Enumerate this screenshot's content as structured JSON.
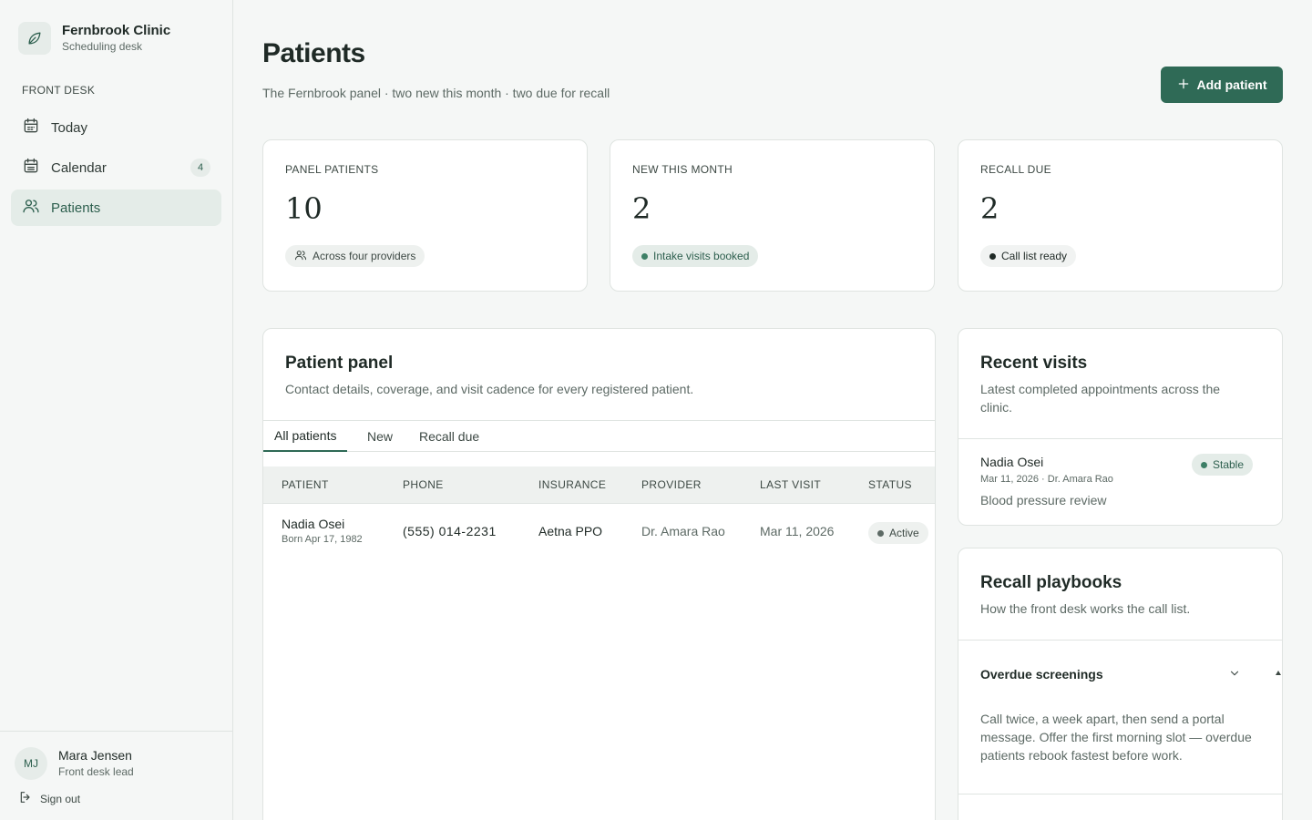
{
  "brand": {
    "name": "Fernbrook Clinic",
    "subtitle": "Scheduling desk"
  },
  "sidebar": {
    "section_label": "FRONT DESK",
    "items": [
      {
        "label": "Today",
        "icon": "calendar-icon"
      },
      {
        "label": "Calendar",
        "icon": "calendar-grid-icon",
        "badge": "4"
      },
      {
        "label": "Patients",
        "icon": "users-icon",
        "active": true
      }
    ]
  },
  "user": {
    "initials": "MJ",
    "name": "Mara Jensen",
    "role": "Front desk lead",
    "signout_label": "Sign out"
  },
  "header": {
    "title": "Patients",
    "subtitle": "The Fernbrook panel · two new this month · two due for recall",
    "add_button": "Add patient"
  },
  "stats": [
    {
      "label": "PANEL PATIENTS",
      "value": "10",
      "pill": "Across four providers"
    },
    {
      "label": "NEW THIS MONTH",
      "value": "2",
      "pill": "Intake visits booked"
    },
    {
      "label": "RECALL DUE",
      "value": "2",
      "pill": "Call list ready"
    }
  ],
  "panel": {
    "title": "Patient panel",
    "subtitle": "Contact details, coverage, and visit cadence for every registered patient.",
    "tabs": [
      "All patients",
      "New",
      "Recall due"
    ],
    "columns": [
      "PATIENT",
      "PHONE",
      "INSURANCE",
      "PROVIDER",
      "LAST VISIT",
      "STATUS"
    ],
    "rows": [
      {
        "name": "Nadia Osei",
        "born": "Born Apr 17, 1982",
        "phone": "(555) 014-2231",
        "insurance": "Aetna PPO",
        "provider": "Dr. Amara Rao",
        "last_visit": "Mar 11, 2026",
        "status": "Active"
      }
    ]
  },
  "recent_visits": {
    "title": "Recent visits",
    "subtitle": "Latest completed appointments across the clinic.",
    "items": [
      {
        "name": "Nadia Osei",
        "meta": "Mar 11, 2026 · Dr. Amara Rao",
        "note": "Blood pressure review",
        "status": "Stable"
      }
    ]
  },
  "playbooks": {
    "title": "Recall playbooks",
    "subtitle": "How the front desk works the call list.",
    "items": [
      {
        "title": "Overdue screenings",
        "body": "Call twice, a week apart, then send a portal message. Offer the first morning slot — overdue patients rebook fastest before work."
      }
    ]
  },
  "colors": {
    "accent": "#2f6a56",
    "accent_soft": "#e4ece8",
    "border": "#dfe4e1",
    "background": "#f5f7f6"
  }
}
